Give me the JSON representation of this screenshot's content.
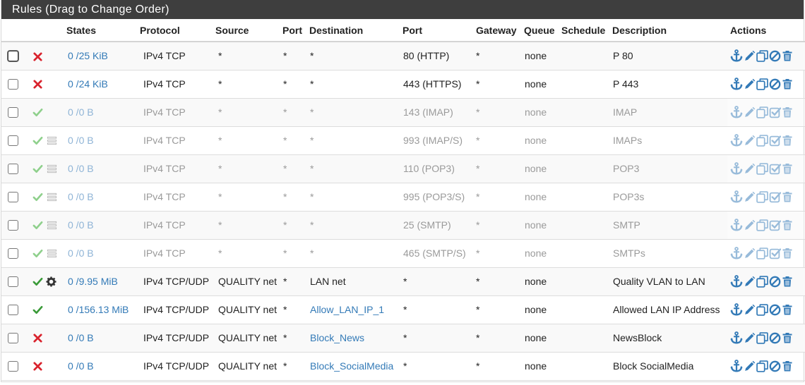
{
  "panel": {
    "title": "Rules (Drag to Change Order)"
  },
  "columns": [
    "",
    "",
    "States",
    "Protocol",
    "Source",
    "Port",
    "Destination",
    "Port",
    "Gateway",
    "Queue",
    "Schedule",
    "Description",
    "Actions"
  ],
  "colors": {
    "block": "#d9232d",
    "pass": "#3a9a38",
    "link": "#337ab7",
    "header_bg": "#3e3e3e"
  },
  "rules": [
    {
      "status": "block",
      "extra": "",
      "disabled": false,
      "states": "0 /25 KiB",
      "protocol": "IPv4 TCP",
      "source": "*",
      "sport": "*",
      "destination": "*",
      "dest_link": false,
      "dport": "80 (HTTP)",
      "gateway": "*",
      "queue": "none",
      "schedule": "",
      "description": "P 80",
      "toggle": "disable"
    },
    {
      "status": "block",
      "extra": "",
      "disabled": false,
      "states": "0 /24 KiB",
      "protocol": "IPv4 TCP",
      "source": "*",
      "sport": "*",
      "destination": "*",
      "dest_link": false,
      "dport": "443 (HTTPS)",
      "gateway": "*",
      "queue": "none",
      "schedule": "",
      "description": "P 443",
      "toggle": "disable"
    },
    {
      "status": "pass",
      "extra": "",
      "disabled": true,
      "states": "0 /0 B",
      "protocol": "IPv4 TCP",
      "source": "*",
      "sport": "*",
      "destination": "*",
      "dest_link": false,
      "dport": "143 (IMAP)",
      "gateway": "*",
      "queue": "none",
      "schedule": "",
      "description": "IMAP",
      "toggle": "enable"
    },
    {
      "status": "pass",
      "extra": "log",
      "disabled": true,
      "states": "0 /0 B",
      "protocol": "IPv4 TCP",
      "source": "*",
      "sport": "*",
      "destination": "*",
      "dest_link": false,
      "dport": "993 (IMAP/S)",
      "gateway": "*",
      "queue": "none",
      "schedule": "",
      "description": "IMAPs",
      "toggle": "enable"
    },
    {
      "status": "pass",
      "extra": "log",
      "disabled": true,
      "states": "0 /0 B",
      "protocol": "IPv4 TCP",
      "source": "*",
      "sport": "*",
      "destination": "*",
      "dest_link": false,
      "dport": "110 (POP3)",
      "gateway": "*",
      "queue": "none",
      "schedule": "",
      "description": "POP3",
      "toggle": "enable"
    },
    {
      "status": "pass",
      "extra": "log",
      "disabled": true,
      "states": "0 /0 B",
      "protocol": "IPv4 TCP",
      "source": "*",
      "sport": "*",
      "destination": "*",
      "dest_link": false,
      "dport": "995 (POP3/S)",
      "gateway": "*",
      "queue": "none",
      "schedule": "",
      "description": "POP3s",
      "toggle": "enable"
    },
    {
      "status": "pass",
      "extra": "log",
      "disabled": true,
      "states": "0 /0 B",
      "protocol": "IPv4 TCP",
      "source": "*",
      "sport": "*",
      "destination": "*",
      "dest_link": false,
      "dport": "25 (SMTP)",
      "gateway": "*",
      "queue": "none",
      "schedule": "",
      "description": "SMTP",
      "toggle": "enable"
    },
    {
      "status": "pass",
      "extra": "log",
      "disabled": true,
      "states": "0 /0 B",
      "protocol": "IPv4 TCP",
      "source": "*",
      "sport": "*",
      "destination": "*",
      "dest_link": false,
      "dport": "465 (SMTP/S)",
      "gateway": "*",
      "queue": "none",
      "schedule": "",
      "description": "SMTPs",
      "toggle": "enable"
    },
    {
      "status": "pass",
      "extra": "gear",
      "disabled": false,
      "states": "0 /9.95 MiB",
      "protocol": "IPv4 TCP/UDP",
      "source": "QUALITY net",
      "sport": "*",
      "destination": "LAN net",
      "dest_link": false,
      "dport": "*",
      "gateway": "*",
      "queue": "none",
      "schedule": "",
      "description": "Quality VLAN to LAN",
      "toggle": "disable"
    },
    {
      "status": "pass",
      "extra": "",
      "disabled": false,
      "states": "0 /156.13 MiB",
      "protocol": "IPv4 TCP/UDP",
      "source": "QUALITY net",
      "sport": "*",
      "destination": "Allow_LAN_IP_1",
      "dest_link": true,
      "dport": "*",
      "gateway": "*",
      "queue": "none",
      "schedule": "",
      "description": "Allowed LAN IP Address",
      "toggle": "disable"
    },
    {
      "status": "block",
      "extra": "",
      "disabled": false,
      "states": "0 /0 B",
      "protocol": "IPv4 TCP/UDP",
      "source": "QUALITY net",
      "sport": "*",
      "destination": "Block_News",
      "dest_link": true,
      "dport": "*",
      "gateway": "*",
      "queue": "none",
      "schedule": "",
      "description": "NewsBlock",
      "toggle": "disable"
    },
    {
      "status": "block",
      "extra": "",
      "disabled": false,
      "states": "0 /0 B",
      "protocol": "IPv4 TCP/UDP",
      "source": "QUALITY net",
      "sport": "*",
      "destination": "Block_SocialMedia",
      "dest_link": true,
      "dport": "*",
      "gateway": "*",
      "queue": "none",
      "schedule": "",
      "description": "Block SocialMedia",
      "toggle": "disable"
    }
  ]
}
